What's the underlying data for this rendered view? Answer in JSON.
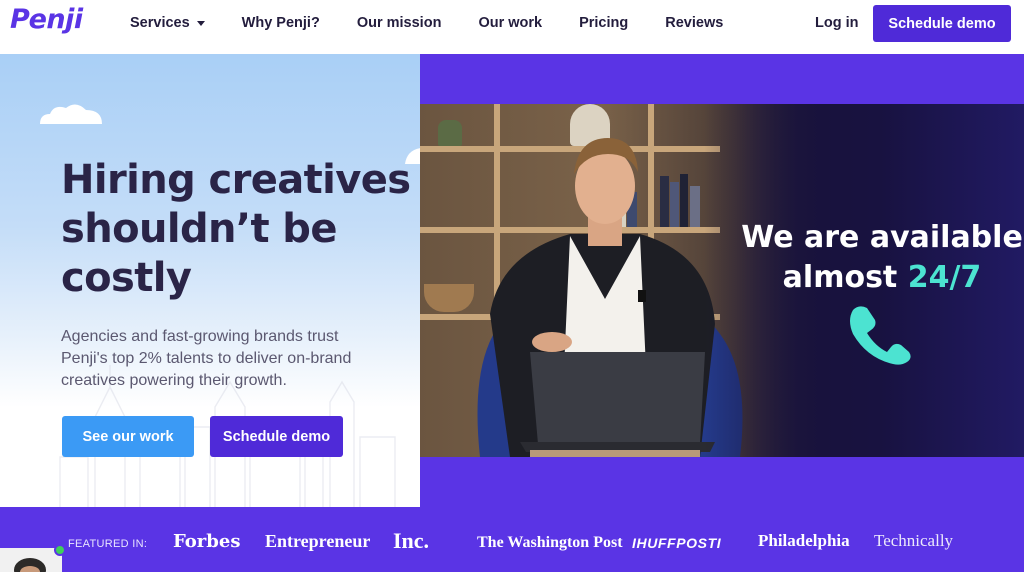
{
  "brand": {
    "logo_text": "Penji",
    "accent": "#5a34e5",
    "cta_color": "#4f2ad8",
    "secondary_button": "#3b9af5",
    "highlight": "#4ce3d1"
  },
  "nav": {
    "items": [
      {
        "label": "Services",
        "has_dropdown": true
      },
      {
        "label": "Why Penji?"
      },
      {
        "label": "Our mission"
      },
      {
        "label": "Our work"
      },
      {
        "label": "Pricing"
      },
      {
        "label": "Reviews"
      }
    ],
    "login": "Log in",
    "cta": "Schedule demo"
  },
  "hero": {
    "headline_lines": [
      "Hiring creatives",
      "shouldn’t be",
      "costly"
    ],
    "subtext": "Agencies and fast-growing brands trust Penji's top 2% talents to deliver on-brand creatives powering their growth.",
    "primary_button": "See our work",
    "secondary_button": "Schedule demo"
  },
  "video": {
    "line1": "We are available",
    "line2_prefix": "almost ",
    "line2_highlight": "24/7",
    "icon": "phone-icon"
  },
  "featured": {
    "label": "FEATURED IN:",
    "logos": [
      "Forbes",
      "Entrepreneur",
      "Inc.",
      "The Washington Post",
      "IHUFFPOSTI",
      "Philadelphia",
      "Technically"
    ]
  },
  "chat": {
    "avatar_icon": "avatar",
    "status": "online"
  }
}
